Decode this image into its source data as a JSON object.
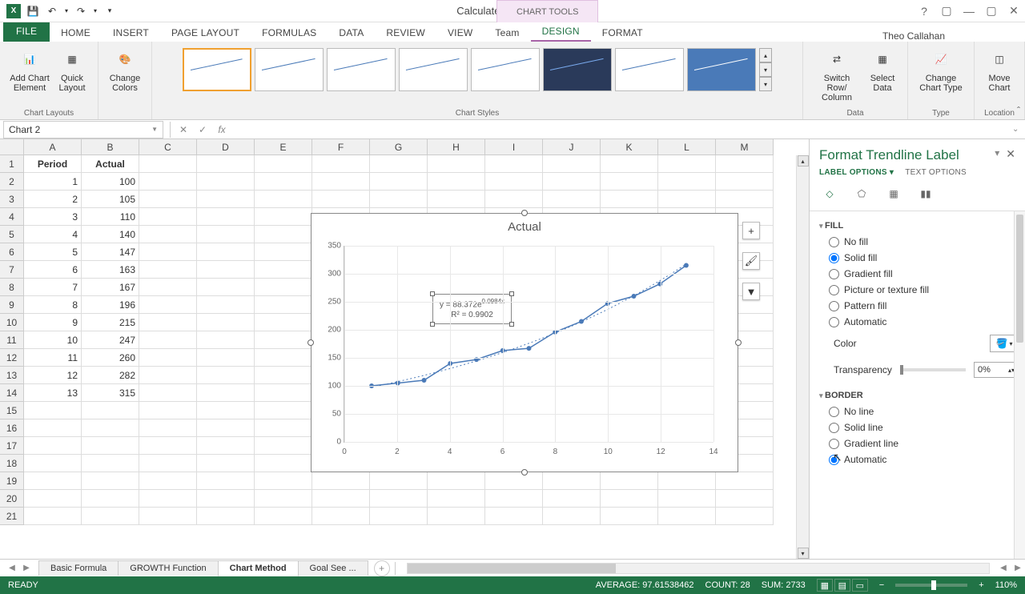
{
  "window": {
    "title": "CalculateGrowth - Excel",
    "chart_tools": "CHART TOOLS",
    "user": "Theo Callahan"
  },
  "tabs": {
    "file": "FILE",
    "home": "HOME",
    "insert": "INSERT",
    "page_layout": "PAGE LAYOUT",
    "formulas": "FORMULAS",
    "data": "DATA",
    "review": "REVIEW",
    "view": "VIEW",
    "team": "Team",
    "design": "DESIGN",
    "format": "FORMAT"
  },
  "ribbon": {
    "add_element": "Add Chart Element",
    "quick_layout": "Quick Layout",
    "change_colors": "Change Colors",
    "switch": "Switch Row/ Column",
    "select_data": "Select Data",
    "change_type": "Change Chart Type",
    "move": "Move Chart",
    "g_layouts": "Chart Layouts",
    "g_styles": "Chart Styles",
    "g_data": "Data",
    "g_type": "Type",
    "g_location": "Location"
  },
  "name_box": "Chart 2",
  "columns": [
    "A",
    "B",
    "C",
    "D",
    "E",
    "F",
    "G",
    "H",
    "I",
    "J",
    "K",
    "L",
    "M"
  ],
  "headers": {
    "a": "Period",
    "b": "Actual"
  },
  "data_rows": [
    {
      "p": 1,
      "a": 100
    },
    {
      "p": 2,
      "a": 105
    },
    {
      "p": 3,
      "a": 110
    },
    {
      "p": 4,
      "a": 140
    },
    {
      "p": 5,
      "a": 147
    },
    {
      "p": 6,
      "a": 163
    },
    {
      "p": 7,
      "a": 167
    },
    {
      "p": 8,
      "a": 196
    },
    {
      "p": 9,
      "a": 215
    },
    {
      "p": 10,
      "a": 247
    },
    {
      "p": 11,
      "a": 260
    },
    {
      "p": 12,
      "a": 282
    },
    {
      "p": 13,
      "a": 315
    }
  ],
  "chart": {
    "title": "Actual",
    "y_ticks": [
      0,
      50,
      100,
      150,
      200,
      250,
      300,
      350
    ],
    "x_ticks": [
      0,
      2,
      4,
      6,
      8,
      10,
      12,
      14
    ],
    "equation": "y = 88.372e",
    "exponent": "0.0984x",
    "r2": "R² = 0.9902"
  },
  "chart_data": {
    "type": "scatter",
    "title": "Actual",
    "xlabel": "",
    "ylabel": "",
    "xlim": [
      0,
      14
    ],
    "ylim": [
      0,
      350
    ],
    "series": [
      {
        "name": "Actual",
        "x": [
          1,
          2,
          3,
          4,
          5,
          6,
          7,
          8,
          9,
          10,
          11,
          12,
          13
        ],
        "y": [
          100,
          105,
          110,
          140,
          147,
          163,
          167,
          196,
          215,
          247,
          260,
          282,
          315
        ]
      }
    ],
    "trendline": {
      "type": "exponential",
      "equation": "y = 88.372e^(0.0984x)",
      "r_squared": 0.9902
    }
  },
  "task_pane": {
    "title": "Format Trendline Label",
    "tab_label": "LABEL OPTIONS",
    "tab_text": "TEXT OPTIONS",
    "fill": "FILL",
    "no_fill": "No fill",
    "solid_fill": "Solid fill",
    "gradient_fill": "Gradient fill",
    "picture_fill": "Picture or texture fill",
    "pattern_fill": "Pattern fill",
    "automatic": "Automatic",
    "color": "Color",
    "transparency": "Transparency",
    "transp_val": "0%",
    "border": "BORDER",
    "no_line": "No line",
    "solid_line": "Solid line",
    "gradient_line": "Gradient line",
    "auto_line": "Automatic"
  },
  "sheets": {
    "s1": "Basic Formula",
    "s2": "GROWTH Function",
    "s3": "Chart Method",
    "s4": "Goal See",
    "more": "..."
  },
  "status": {
    "ready": "READY",
    "avg": "AVERAGE: 97.61538462",
    "count": "COUNT: 28",
    "sum": "SUM: 2733",
    "zoom": "110%"
  }
}
